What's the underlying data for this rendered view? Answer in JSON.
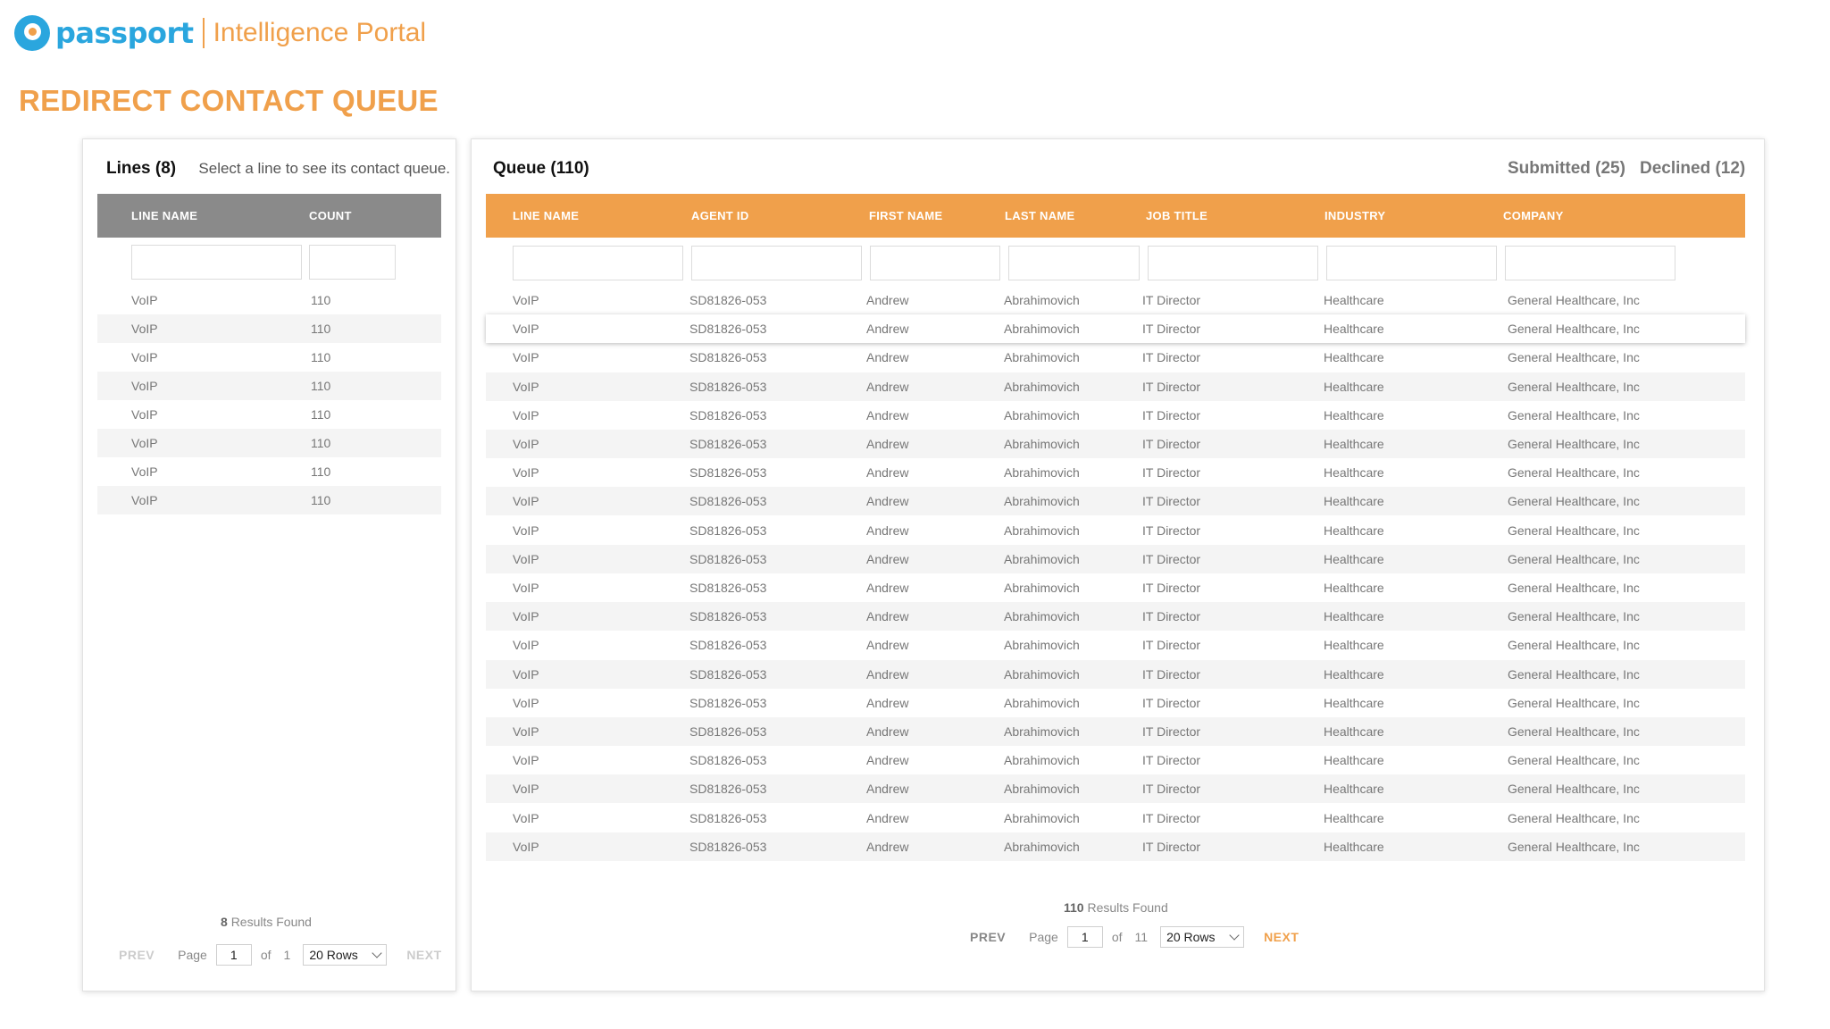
{
  "brand": {
    "logo_text": "passport",
    "portal_name": "Intelligence Portal"
  },
  "page_title": "REDIRECT CONTACT QUEUE",
  "colors": {
    "accent": "#f0a04b",
    "brand_blue": "#2aa6de",
    "grey_header": "#8a8a8a"
  },
  "lines_panel": {
    "title": "Lines (8)",
    "hint": "Select a line to see its contact queue.",
    "columns": [
      "LINE NAME",
      "COUNT"
    ],
    "rows": [
      [
        "VoIP",
        "110"
      ],
      [
        "VoIP",
        "110"
      ],
      [
        "VoIP",
        "110"
      ],
      [
        "VoIP",
        "110"
      ],
      [
        "VoIP",
        "110"
      ],
      [
        "VoIP",
        "110"
      ],
      [
        "VoIP",
        "110"
      ],
      [
        "VoIP",
        "110"
      ]
    ],
    "results_count": "8",
    "results_label": "Results Found",
    "pager": {
      "prev": "PREV",
      "page_label": "Page",
      "page": "1",
      "of_label": "of",
      "total_pages": "1",
      "rows": "20 Rows",
      "next": "NEXT"
    }
  },
  "queue_panel": {
    "title": "Queue (110)",
    "submitted": "Submitted (25)",
    "declined": "Declined (12)",
    "columns": [
      "LINE NAME",
      "AGENT ID",
      "FIRST NAME",
      "LAST NAME",
      "JOB TITLE",
      "INDUSTRY",
      "COMPANY"
    ],
    "rows": [
      [
        "VoIP",
        "SD81826-053",
        "Andrew",
        "Abrahimovich",
        "IT Director",
        "Healthcare",
        "General Healthcare, Inc"
      ],
      [
        "VoIP",
        "SD81826-053",
        "Andrew",
        "Abrahimovich",
        "IT Director",
        "Healthcare",
        "General Healthcare, Inc"
      ],
      [
        "VoIP",
        "SD81826-053",
        "Andrew",
        "Abrahimovich",
        "IT Director",
        "Healthcare",
        "General Healthcare, Inc"
      ],
      [
        "VoIP",
        "SD81826-053",
        "Andrew",
        "Abrahimovich",
        "IT Director",
        "Healthcare",
        "General Healthcare, Inc"
      ],
      [
        "VoIP",
        "SD81826-053",
        "Andrew",
        "Abrahimovich",
        "IT Director",
        "Healthcare",
        "General Healthcare, Inc"
      ],
      [
        "VoIP",
        "SD81826-053",
        "Andrew",
        "Abrahimovich",
        "IT Director",
        "Healthcare",
        "General Healthcare, Inc"
      ],
      [
        "VoIP",
        "SD81826-053",
        "Andrew",
        "Abrahimovich",
        "IT Director",
        "Healthcare",
        "General Healthcare, Inc"
      ],
      [
        "VoIP",
        "SD81826-053",
        "Andrew",
        "Abrahimovich",
        "IT Director",
        "Healthcare",
        "General Healthcare, Inc"
      ],
      [
        "VoIP",
        "SD81826-053",
        "Andrew",
        "Abrahimovich",
        "IT Director",
        "Healthcare",
        "General Healthcare, Inc"
      ],
      [
        "VoIP",
        "SD81826-053",
        "Andrew",
        "Abrahimovich",
        "IT Director",
        "Healthcare",
        "General Healthcare, Inc"
      ],
      [
        "VoIP",
        "SD81826-053",
        "Andrew",
        "Abrahimovich",
        "IT Director",
        "Healthcare",
        "General Healthcare, Inc"
      ],
      [
        "VoIP",
        "SD81826-053",
        "Andrew",
        "Abrahimovich",
        "IT Director",
        "Healthcare",
        "General Healthcare, Inc"
      ],
      [
        "VoIP",
        "SD81826-053",
        "Andrew",
        "Abrahimovich",
        "IT Director",
        "Healthcare",
        "General Healthcare, Inc"
      ],
      [
        "VoIP",
        "SD81826-053",
        "Andrew",
        "Abrahimovich",
        "IT Director",
        "Healthcare",
        "General Healthcare, Inc"
      ],
      [
        "VoIP",
        "SD81826-053",
        "Andrew",
        "Abrahimovich",
        "IT Director",
        "Healthcare",
        "General Healthcare, Inc"
      ],
      [
        "VoIP",
        "SD81826-053",
        "Andrew",
        "Abrahimovich",
        "IT Director",
        "Healthcare",
        "General Healthcare, Inc"
      ],
      [
        "VoIP",
        "SD81826-053",
        "Andrew",
        "Abrahimovich",
        "IT Director",
        "Healthcare",
        "General Healthcare, Inc"
      ],
      [
        "VoIP",
        "SD81826-053",
        "Andrew",
        "Abrahimovich",
        "IT Director",
        "Healthcare",
        "General Healthcare, Inc"
      ],
      [
        "VoIP",
        "SD81826-053",
        "Andrew",
        "Abrahimovich",
        "IT Director",
        "Healthcare",
        "General Healthcare, Inc"
      ],
      [
        "VoIP",
        "SD81826-053",
        "Andrew",
        "Abrahimovich",
        "IT Director",
        "Healthcare",
        "General Healthcare, Inc"
      ]
    ],
    "selected_row": 1,
    "results_count": "110",
    "results_label": "Results Found",
    "pager": {
      "prev": "PREV",
      "page_label": "Page",
      "page": "1",
      "of_label": "of",
      "total_pages": "11",
      "rows": "20 Rows",
      "next": "NEXT"
    }
  }
}
